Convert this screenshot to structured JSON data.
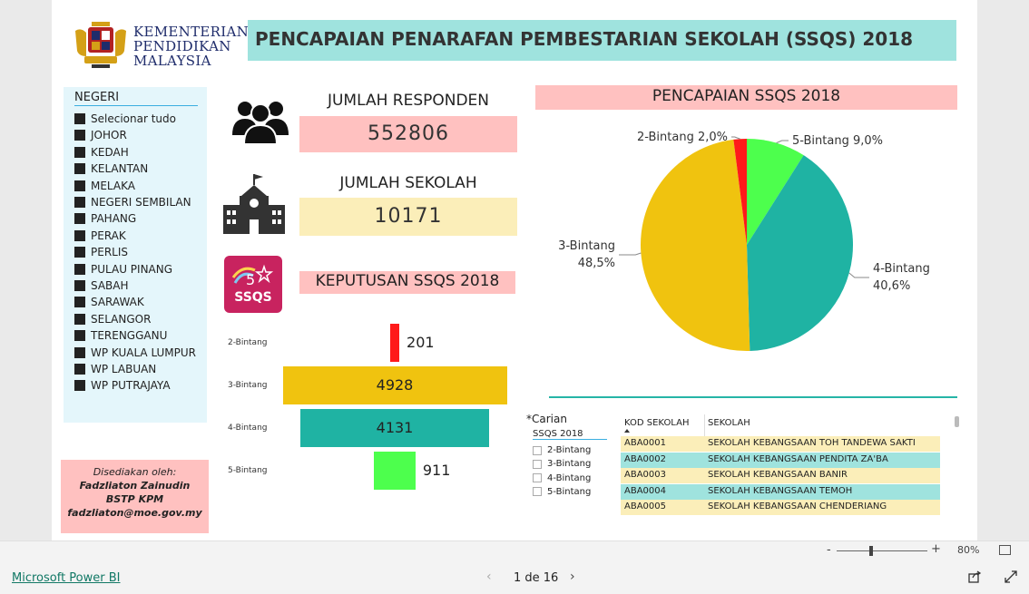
{
  "header": {
    "ministry_lines": [
      "KEMENTERIAN",
      "PENDIDIKAN",
      "MALAYSIA"
    ],
    "title": "PENCAPAIAN PENARAFAN PEMBESTARIAN SEKOLAH (SSQS) 2018"
  },
  "slicer": {
    "title": "NEGERI",
    "items": [
      "Selecionar tudo",
      "JOHOR",
      "KEDAH",
      "KELANTAN",
      "MELAKA",
      "NEGERI SEMBILAN",
      "PAHANG",
      "PERAK",
      "PERLIS",
      "PULAU PINANG",
      "SABAH",
      "SARAWAK",
      "SELANGOR",
      "TERENGGANU",
      "WP KUALA LUMPUR",
      "WP LABUAN",
      "WP PUTRAJAYA"
    ]
  },
  "info": {
    "line1": "Disediakan oleh:",
    "line2": "Fadzliaton Zainudin",
    "line3": "BSTP KPM",
    "line4": "fadzliaton@moe.gov.my"
  },
  "kpi": {
    "responden_label": "JUMLAH RESPONDEN",
    "responden_value": "552806",
    "sekolah_label": "JUMLAH SEKOLAH",
    "sekolah_value": "10171",
    "keputusan_label": "KEPUTUSAN SSQS 2018",
    "ssqs_logo_text": "SSQS"
  },
  "funnel": {
    "items": [
      {
        "label": "2-Bintang",
        "value": 201,
        "value_text": "201",
        "color": "#ff1a1a"
      },
      {
        "label": "3-Bintang",
        "value": 4928,
        "value_text": "4928",
        "color": "#f0c30f"
      },
      {
        "label": "4-Bintang",
        "value": 4131,
        "value_text": "4131",
        "color": "#1fb3a3"
      },
      {
        "label": "5-Bintang",
        "value": 911,
        "value_text": "911",
        "color": "#4dff4d"
      }
    ]
  },
  "chart_data": {
    "type": "pie",
    "title": "PENCAPAIAN SSQS 2018",
    "slices": [
      {
        "label": "5-Bintang",
        "value": 9.0,
        "value_text": "9,0%",
        "color": "#4dff4d"
      },
      {
        "label": "4-Bintang",
        "value": 40.6,
        "value_text": "40,6%",
        "color": "#1fb3a3"
      },
      {
        "label": "3-Bintang",
        "value": 48.5,
        "value_text": "48,5%",
        "color": "#f0c30f"
      },
      {
        "label": "2-Bintang",
        "value": 2.0,
        "value_text": "2,0%",
        "color": "#ff1a1a"
      }
    ]
  },
  "filter": {
    "carian": "*Carian",
    "title": "SSQS 2018",
    "options": [
      "2-Bintang",
      "3-Bintang",
      "4-Bintang",
      "5-Bintang"
    ]
  },
  "table": {
    "columns": [
      "KOD SEKOLAH",
      "SEKOLAH"
    ],
    "rows": [
      {
        "kod": "ABA0001",
        "sekolah": "SEKOLAH KEBANGSAAN TOH TANDEWA SAKTI",
        "color": "#fbeeb9"
      },
      {
        "kod": "ABA0002",
        "sekolah": "SEKOLAH KEBANGSAAN PENDITA ZA'BA",
        "color": "#9fe3de"
      },
      {
        "kod": "ABA0003",
        "sekolah": "SEKOLAH KEBANGSAAN BANIR",
        "color": "#fbeeb9"
      },
      {
        "kod": "ABA0004",
        "sekolah": "SEKOLAH KEBANGSAAN TEMOH",
        "color": "#9fe3de"
      },
      {
        "kod": "ABA0005",
        "sekolah": "SEKOLAH KEBANGSAAN CHENDERIANG",
        "color": "#fbeeb9"
      }
    ]
  },
  "zoom": {
    "minus": "-",
    "plus": "+",
    "value": "80%",
    "level": 0.4
  },
  "footer": {
    "powerbi_link": "Microsoft Power BI",
    "page": "1 de 16",
    "prev": "‹",
    "next": "›"
  }
}
